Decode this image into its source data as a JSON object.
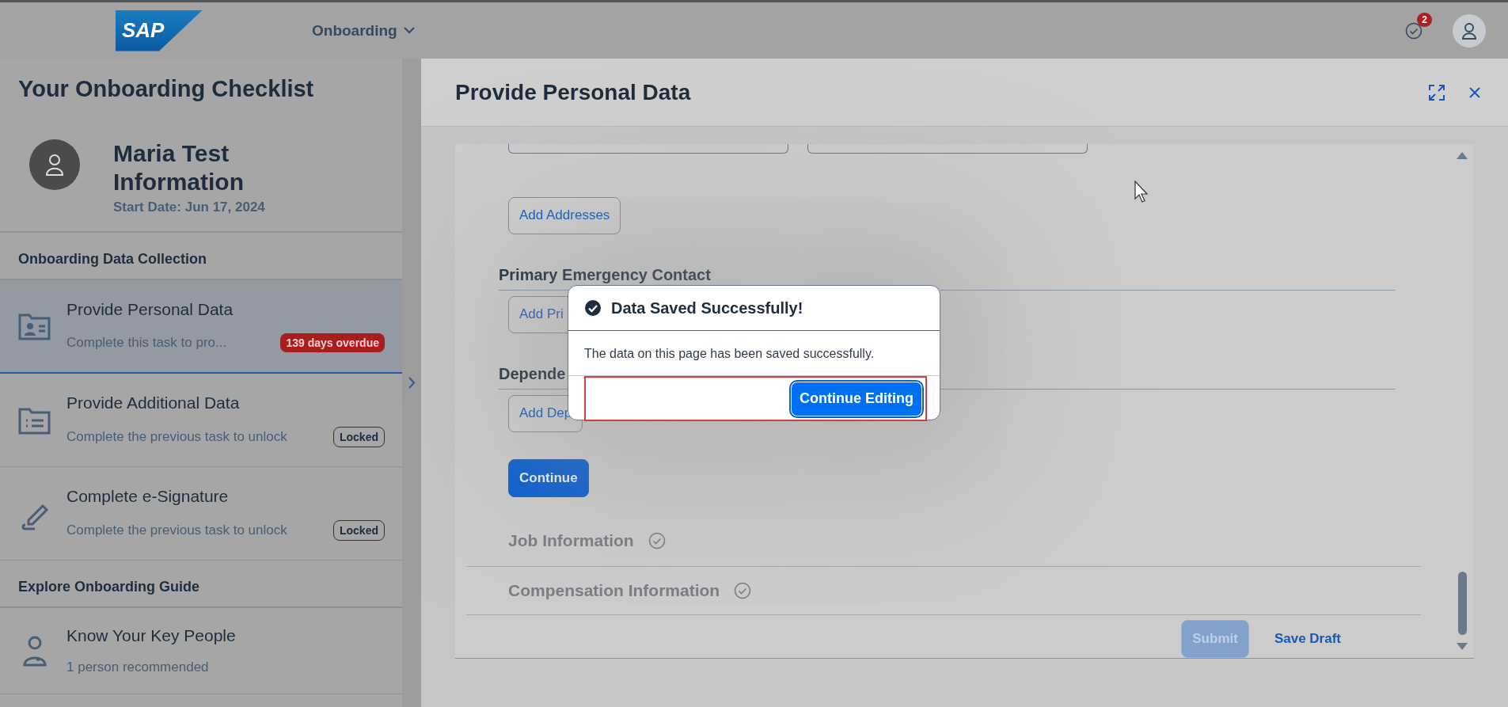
{
  "header": {
    "logo": "SAP",
    "menu": "Onboarding",
    "notification_count": "2"
  },
  "sidebar": {
    "title": "Your Onboarding Checklist",
    "profile": {
      "name": "Maria Test Information",
      "start_date": "Start Date: Jun 17, 2024"
    },
    "sections": [
      {
        "title": "Onboarding Data Collection",
        "items": [
          {
            "kind": "personal",
            "title": "Provide Personal Data",
            "subtitle": "Complete this task to pro...",
            "badge": "139 days overdue",
            "overdue": true,
            "selected": true
          },
          {
            "kind": "list",
            "title": "Provide Additional Data",
            "subtitle": "Complete the previous task to unlock",
            "badge": "Locked",
            "overdue": false,
            "selected": false
          },
          {
            "kind": "signature",
            "title": "Complete e-Signature",
            "subtitle": "Complete the previous task to unlock",
            "badge": "Locked",
            "overdue": false,
            "selected": false
          }
        ]
      },
      {
        "title": "Explore Onboarding Guide",
        "items": [
          {
            "kind": "people",
            "title": "Know Your Key People",
            "subtitle": "1 person recommended",
            "selected": false
          }
        ]
      }
    ]
  },
  "main": {
    "title": "Provide Personal Data",
    "form": [
      {
        "kind": "fields"
      },
      {
        "kind": "button",
        "label": "Add Addresses"
      },
      {
        "kind": "heading",
        "label": "Primary Emergency Contact"
      },
      {
        "kind": "button",
        "label": "Add Pri"
      },
      {
        "kind": "heading",
        "label": "Depende"
      },
      {
        "kind": "button",
        "label": "Add Dep"
      },
      {
        "kind": "primary",
        "label": "Continue"
      },
      {
        "kind": "section",
        "label": "Job Information",
        "completed": true
      },
      {
        "kind": "section",
        "label": "Compensation Information",
        "completed": true
      }
    ],
    "footer": [
      {
        "kind": "primary",
        "label": "Submit",
        "disabled": true
      },
      {
        "kind": "link",
        "label": "Save Draft",
        "disabled": false
      }
    ]
  },
  "dialog": {
    "title": "Data Saved Successfully!",
    "message": "The data on this page has been saved successfully.",
    "button": "Continue Editing"
  }
}
